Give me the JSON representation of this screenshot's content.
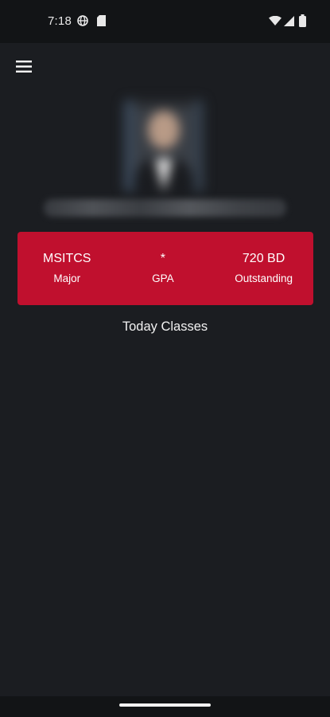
{
  "status_bar": {
    "time": "7:18",
    "icons": [
      "vpn-globe-icon",
      "sim-card-icon",
      "wifi-icon",
      "signal-icon",
      "battery-icon"
    ]
  },
  "app_bar": {
    "menu_icon": "hamburger-menu-icon"
  },
  "profile": {
    "avatar_blurred": true,
    "name_blurred": true
  },
  "summary": {
    "major_value": "MSITCS",
    "major_label": "Major",
    "gpa_value": "*",
    "gpa_label": "GPA",
    "outstanding_value": "720 BD",
    "outstanding_label": "Outstanding"
  },
  "sections": {
    "today_classes": "Today Classes"
  },
  "colors": {
    "background": "#1b1d21",
    "status_bar": "#121416",
    "accent_red": "#c0102e",
    "text": "#ffffff"
  }
}
